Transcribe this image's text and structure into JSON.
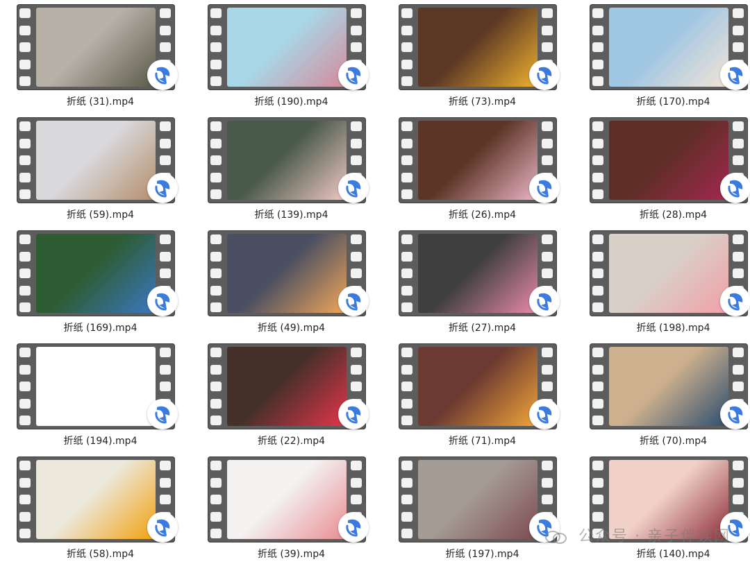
{
  "files": [
    {
      "name": "折纸 (31).mp4",
      "thumb_colors": [
        "#b7b0a7",
        "#5a5a4a"
      ],
      "thumb_icon": "ornaments-thumbnail"
    },
    {
      "name": "折纸 (190).mp4",
      "thumb_colors": [
        "#a8d7e7",
        "#d58a9b"
      ],
      "thumb_icon": "paper-roses-thumbnail"
    },
    {
      "name": "折纸 (73).mp4",
      "thumb_colors": [
        "#5b3726",
        "#f0b12f"
      ],
      "thumb_icon": "sunflowers-thumbnail"
    },
    {
      "name": "折纸 (170).mp4",
      "thumb_colors": [
        "#9fc6e3",
        "#f3e4d6"
      ],
      "thumb_icon": "wreath-thumbnail"
    },
    {
      "name": "折纸 (59).mp4",
      "thumb_colors": [
        "#d9d9dc",
        "#b58e6c"
      ],
      "thumb_icon": "gift-bows-thumbnail"
    },
    {
      "name": "折纸 (139).mp4",
      "thumb_colors": [
        "#4a5a4a",
        "#f0c8c5"
      ],
      "thumb_icon": "gift-tags-thumbnail"
    },
    {
      "name": "折纸 (26).mp4",
      "thumb_colors": [
        "#5d3526",
        "#e9b5c6"
      ],
      "thumb_icon": "hanging-flowers-thumbnail"
    },
    {
      "name": "折纸 (28).mp4",
      "thumb_colors": [
        "#5e2e25",
        "#a2284f"
      ],
      "thumb_icon": "paper-cups-thumbnail"
    },
    {
      "name": "折纸 (169).mp4",
      "thumb_colors": [
        "#2d5c32",
        "#3a78c2"
      ],
      "thumb_icon": "christmas-stars-thumbnail"
    },
    {
      "name": "折纸 (49).mp4",
      "thumb_colors": [
        "#4a4f62",
        "#f1a65a"
      ],
      "thumb_icon": "pumpkins-thumbnail"
    },
    {
      "name": "折纸 (27).mp4",
      "thumb_colors": [
        "#3f3f40",
        "#e98aa8"
      ],
      "thumb_icon": "daisies-thumbnail"
    },
    {
      "name": "折纸 (198).mp4",
      "thumb_colors": [
        "#d9d0c8",
        "#f0a0a8"
      ],
      "thumb_icon": "flower-cup-thumbnail"
    },
    {
      "name": "折纸 (194).mp4",
      "thumb_colors": [
        "#ffffff",
        "#ffffff"
      ],
      "thumb_icon": "blank-thumbnail"
    },
    {
      "name": "折纸 (22).mp4",
      "thumb_colors": [
        "#45302a",
        "#e5354a"
      ],
      "thumb_icon": "pompom-hearts-thumbnail"
    },
    {
      "name": "折纸 (71).mp4",
      "thumb_colors": [
        "#6b3a32",
        "#f2a53a"
      ],
      "thumb_icon": "hand-flower-thumbnail"
    },
    {
      "name": "折纸 (70).mp4",
      "thumb_colors": [
        "#cdb08e",
        "#2c4d6e"
      ],
      "thumb_icon": "feather-thumbnail"
    },
    {
      "name": "折纸 (58).mp4",
      "thumb_colors": [
        "#ece8dc",
        "#f2a20f"
      ],
      "thumb_icon": "sunflower-cake-thumbnail"
    },
    {
      "name": "折纸 (39).mp4",
      "thumb_colors": [
        "#f4f1f1",
        "#e88d92"
      ],
      "thumb_icon": "quilled-hearts-thumbnail"
    },
    {
      "name": "折纸 (197).mp4",
      "thumb_colors": [
        "#a59b95",
        "#7d4b4f"
      ],
      "thumb_icon": "quilled-flowers-thumbnail"
    },
    {
      "name": "折纸 (140).mp4",
      "thumb_colors": [
        "#f2d1c8",
        "#8d2e3b"
      ],
      "thumb_icon": "paper-flowers-thumbnail"
    }
  ],
  "player_badge": {
    "icon": "media-player-icon",
    "color": "#3b7be0"
  },
  "watermark": {
    "text": "公众号 · 亲子伴读网",
    "icon": "wechat-icon"
  }
}
